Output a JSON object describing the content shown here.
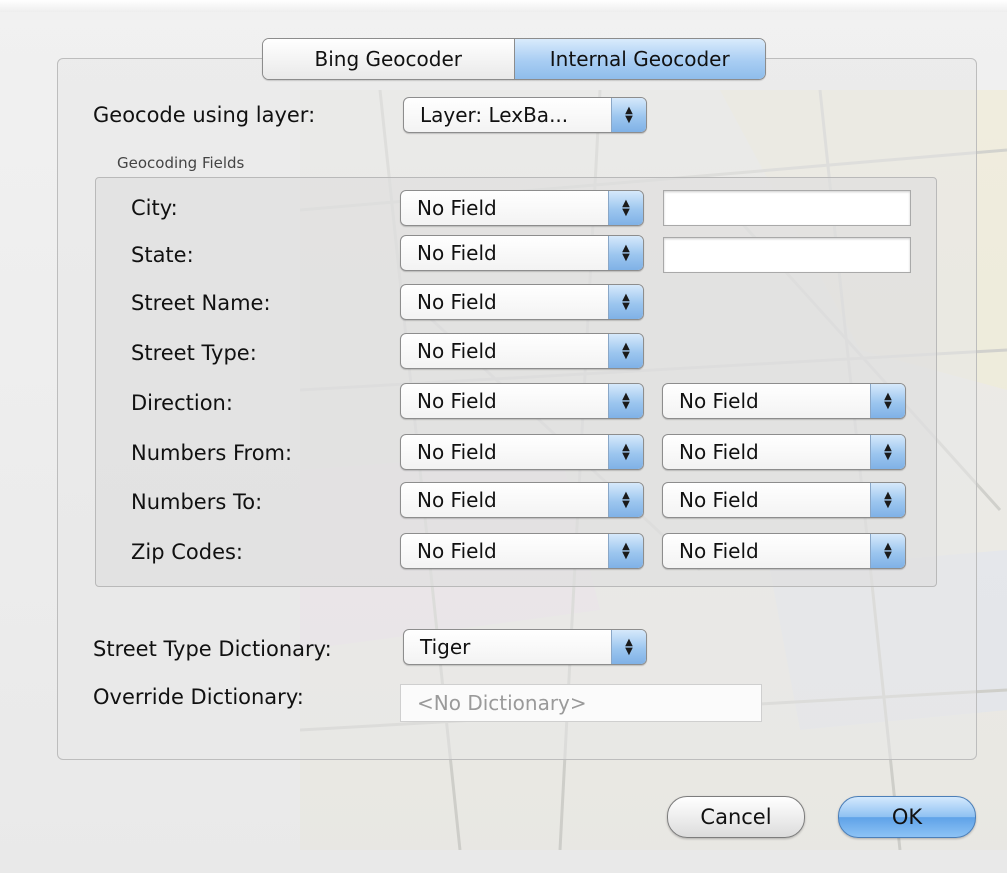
{
  "tabs": [
    {
      "label": "Bing Geocoder",
      "selected": false
    },
    {
      "label": "Internal Geocoder",
      "selected": true
    }
  ],
  "geocode_layer": {
    "label": "Geocode using layer:",
    "value": "Layer: LexBa..."
  },
  "fields_group": {
    "title": "Geocoding Fields"
  },
  "fields": [
    {
      "label": "City:",
      "primary": "No Field"
    },
    {
      "label": "State:",
      "primary": "No Field"
    },
    {
      "label": "Street Name:",
      "primary": "No Field"
    },
    {
      "label": "Street Type:",
      "primary": "No Field"
    },
    {
      "label": "Direction:",
      "primary": "No Field",
      "secondary": "No Field"
    },
    {
      "label": "Numbers From:",
      "primary": "No Field",
      "secondary": "No Field"
    },
    {
      "label": "Numbers To:",
      "primary": "No Field",
      "secondary": "No Field"
    },
    {
      "label": "Zip Codes:",
      "primary": "No Field",
      "secondary": "No Field"
    }
  ],
  "street_type_dictionary": {
    "label": "Street Type Dictionary:",
    "value": "Tiger"
  },
  "override_dictionary": {
    "label": "Override Dictionary:",
    "placeholder": "<No Dictionary>"
  },
  "buttons": {
    "cancel": "Cancel",
    "ok": "OK"
  },
  "colors": {
    "accent": "#8fbdeb",
    "window_bg": "#ececec"
  }
}
